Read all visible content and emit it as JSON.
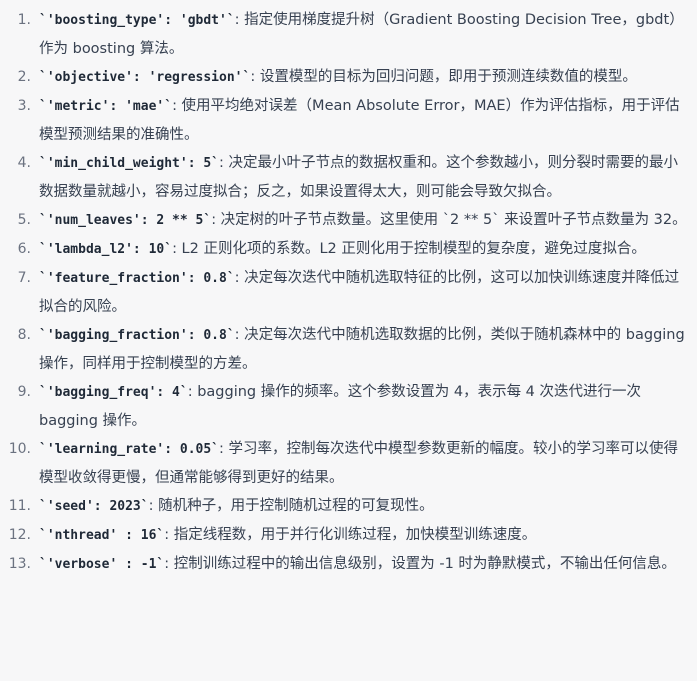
{
  "items": [
    {
      "num": "1.",
      "code": "`'boosting_type': 'gbdt'`",
      "text": ": 指定使用梯度提升树（Gradient Boosting Decision Tree，gbdt）作为 boosting 算法。"
    },
    {
      "num": "2.",
      "code": "`'objective': 'regression'`",
      "text": ": 设置模型的目标为回归问题，即用于预测连续数值的模型。"
    },
    {
      "num": "3.",
      "code": "`'metric': 'mae'`",
      "text": ": 使用平均绝对误差（Mean Absolute Error，MAE）作为评估指标，用于评估模型预测结果的准确性。"
    },
    {
      "num": "4.",
      "code": "`'min_child_weight': 5`",
      "text": ": 决定最小叶子节点的数据权重和。这个参数越小，则分裂时需要的最小数据数量就越小，容易过度拟合；反之，如果设置得太大，则可能会导致欠拟合。"
    },
    {
      "num": "5.",
      "code": "`'num_leaves': 2 ** 5`",
      "text": ": 决定树的叶子节点数量。这里使用 `2 ** 5` 来设置叶子节点数量为 32。"
    },
    {
      "num": "6.",
      "code": "`'lambda_l2': 10`",
      "text": ": L2 正则化项的系数。L2 正则化用于控制模型的复杂度，避免过度拟合。"
    },
    {
      "num": "7.",
      "code": "`'feature_fraction': 0.8`",
      "text": ": 决定每次迭代中随机选取特征的比例，这可以加快训练速度并降低过拟合的风险。"
    },
    {
      "num": "8.",
      "code": "`'bagging_fraction': 0.8`",
      "text": ": 决定每次迭代中随机选取数据的比例，类似于随机森林中的 bagging 操作，同样用于控制模型的方差。"
    },
    {
      "num": "9.",
      "code": "`'bagging_freq': 4`",
      "text": ": bagging 操作的频率。这个参数设置为 4，表示每 4 次迭代进行一次 bagging 操作。"
    },
    {
      "num": "10.",
      "code": "`'learning_rate': 0.05`",
      "text": ": 学习率，控制每次迭代中模型参数更新的幅度。较小的学习率可以使得模型收敛得更慢，但通常能够得到更好的结果。"
    },
    {
      "num": "11.",
      "code": "`'seed': 2023`",
      "text": ": 随机种子，用于控制随机过程的可复现性。"
    },
    {
      "num": "12.",
      "code": "`'nthread' : 16`",
      "text": ": 指定线程数，用于并行化训练过程，加快模型训练速度。"
    },
    {
      "num": "13.",
      "code": "`'verbose' : -1`",
      "text": ": 控制训练过程中的输出信息级别，设置为 -1 时为静默模式，不输出任何信息。"
    }
  ]
}
